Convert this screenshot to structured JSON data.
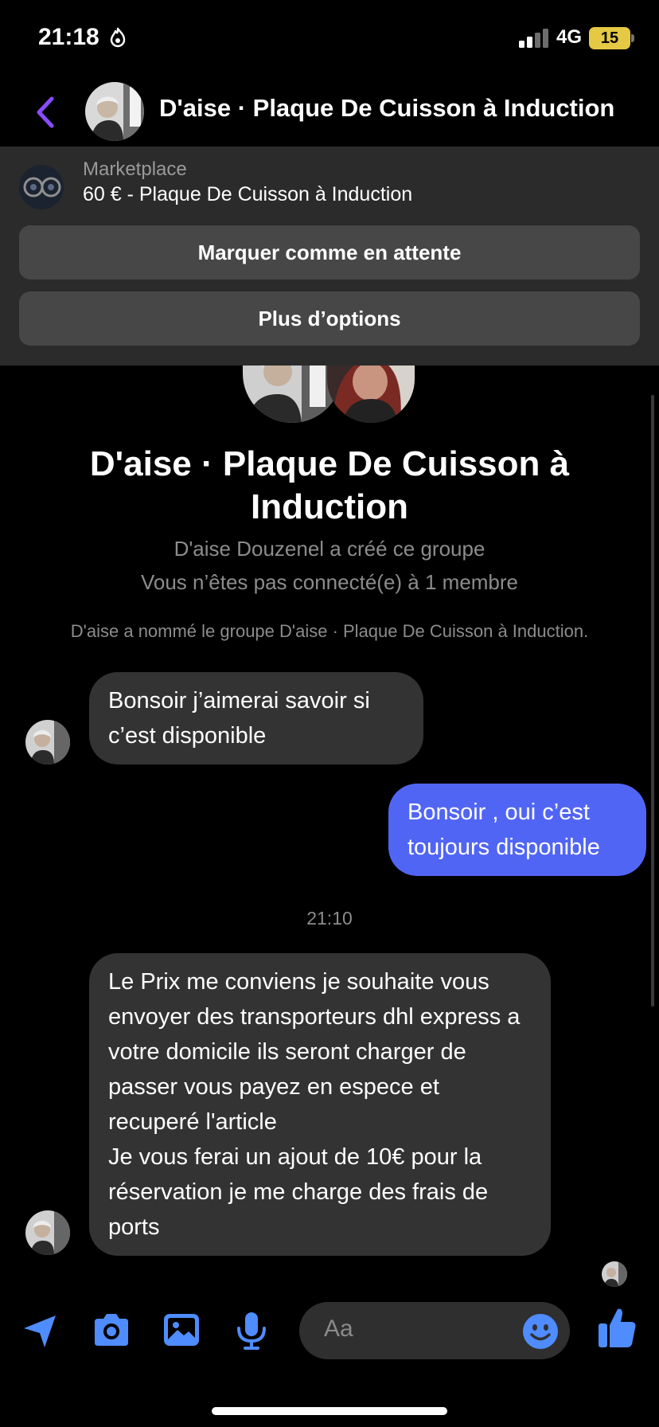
{
  "status_bar": {
    "time": "21:18",
    "network": "4G",
    "battery": "15",
    "battery_color": "#e5c843"
  },
  "header": {
    "title": "D'aise · Plaque De Cuisson à Induction"
  },
  "marketplace": {
    "label": "Marketplace",
    "item": "60 € - Plaque De Cuisson à Induction",
    "buttons": [
      "Marquer comme en attente",
      "Plus d’options"
    ]
  },
  "group": {
    "title": "D'aise · Plaque De Cuisson à Induction",
    "created_by": "D'aise Douzenel a créé ce groupe",
    "connection": "Vous n’êtes pas connecté(e) à 1 membre",
    "event": "D'aise a nommé le groupe D'aise · Plaque De Cuisson à Induction."
  },
  "messages": [
    {
      "direction": "incoming",
      "text": "Bonsoir j’aimerai savoir si c’est disponible"
    },
    {
      "direction": "outgoing",
      "text": "Bonsoir , oui c’est toujours disponible"
    },
    {
      "direction": "incoming",
      "text": "Le Prix me conviens je souhaite vous envoyer des transporteurs dhl express a votre domicile ils seront charger de passer vous payez en espece et recuperé l'article\nJe vous ferai un ajout de 10€ pour la réservation je me charge des frais de ports"
    }
  ],
  "timestamp": "21:10",
  "composer": {
    "placeholder": "Aa"
  },
  "icons": {
    "back": "chevron-left-icon",
    "send_location": "location-arrow-icon",
    "camera": "camera-icon",
    "gallery": "image-icon",
    "mic": "microphone-icon",
    "emoji": "smiley-icon",
    "like": "thumbs-up-icon"
  },
  "colors": {
    "accent": "#5165f5",
    "back_arrow": "#8a4bff",
    "bubble_incoming": "#333333",
    "panel": "#2b2b2b",
    "panel_button": "#474747"
  }
}
